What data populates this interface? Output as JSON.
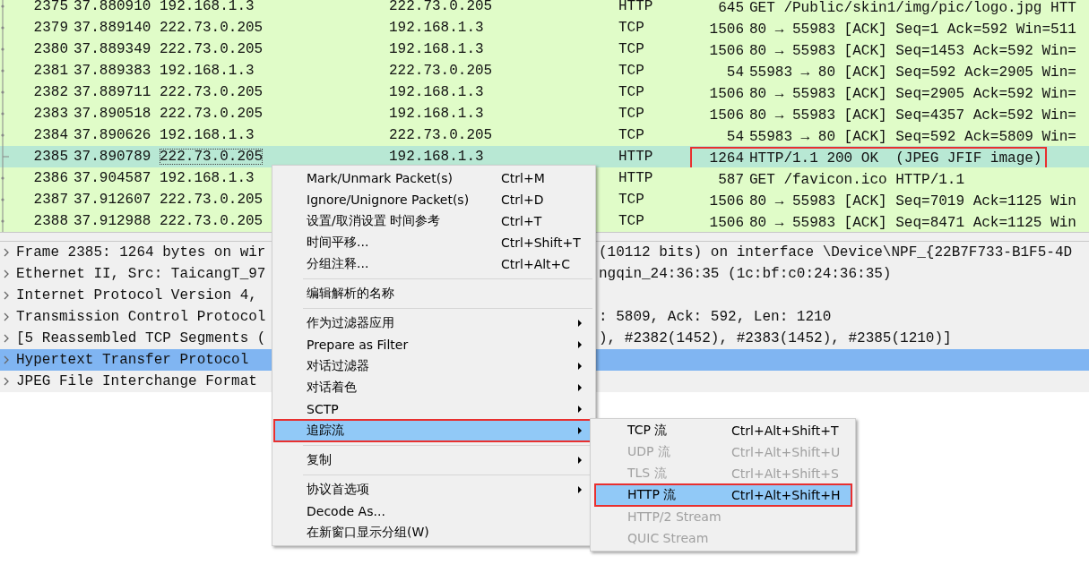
{
  "packet_list": {
    "rows": [
      {
        "no": "2375",
        "time": "37.880910",
        "source": "192.168.1.3",
        "destination": "222.73.0.205",
        "protocol": "HTTP",
        "length": "645",
        "info": "GET /Public/skin1/img/pic/logo.jpg HTT",
        "selected": false,
        "outlined": false
      },
      {
        "no": "2379",
        "time": "37.889140",
        "source": "222.73.0.205",
        "destination": "192.168.1.3",
        "protocol": "TCP",
        "length": "1506",
        "info": "80 → 55983 [ACK] Seq=1 Ack=592 Win=511",
        "selected": false,
        "outlined": false
      },
      {
        "no": "2380",
        "time": "37.889349",
        "source": "222.73.0.205",
        "destination": "192.168.1.3",
        "protocol": "TCP",
        "length": "1506",
        "info": "80 → 55983 [ACK] Seq=1453 Ack=592 Win=",
        "selected": false,
        "outlined": false
      },
      {
        "no": "2381",
        "time": "37.889383",
        "source": "192.168.1.3",
        "destination": "222.73.0.205",
        "protocol": "TCP",
        "length": "54",
        "info": "55983 → 80 [ACK] Seq=592 Ack=2905 Win=",
        "selected": false,
        "outlined": false
      },
      {
        "no": "2382",
        "time": "37.889711",
        "source": "222.73.0.205",
        "destination": "192.168.1.3",
        "protocol": "TCP",
        "length": "1506",
        "info": "80 → 55983 [ACK] Seq=2905 Ack=592 Win=",
        "selected": false,
        "outlined": false
      },
      {
        "no": "2383",
        "time": "37.890518",
        "source": "222.73.0.205",
        "destination": "192.168.1.3",
        "protocol": "TCP",
        "length": "1506",
        "info": "80 → 55983 [ACK] Seq=4357 Ack=592 Win=",
        "selected": false,
        "outlined": false
      },
      {
        "no": "2384",
        "time": "37.890626",
        "source": "192.168.1.3",
        "destination": "222.73.0.205",
        "protocol": "TCP",
        "length": "54",
        "info": "55983 → 80 [ACK] Seq=592 Ack=5809 Win=",
        "selected": false,
        "outlined": false
      },
      {
        "no": "2385",
        "time": "37.890789",
        "source": "222.73.0.205",
        "destination": "192.168.1.3",
        "protocol": "HTTP",
        "length": "1264",
        "info": "HTTP/1.1 200 OK  (JPEG JFIF image)",
        "selected": true,
        "outlined": true
      },
      {
        "no": "2386",
        "time": "37.904587",
        "source": "192.168.1.3",
        "protocol": "HTTP",
        "length": "587",
        "info": "GET /favicon.ico HTTP/1.1",
        "selected": false,
        "outlined": false
      },
      {
        "no": "2387",
        "time": "37.912607",
        "source": "222.73.0.205",
        "protocol": "TCP",
        "length": "1506",
        "info": "80 → 55983 [ACK] Seq=7019 Ack=1125 Win",
        "selected": false,
        "outlined": false
      },
      {
        "no": "2388",
        "time": "37.912988",
        "source": "222.73.0.205",
        "protocol": "TCP",
        "length": "1506",
        "info": "80 → 55983 [ACK] Seq=8471 Ack=1125 Win",
        "selected": false,
        "outlined": false
      }
    ]
  },
  "packet_details": {
    "rows": [
      {
        "left": "Frame 2385: 1264 bytes on wir",
        "right": "(10112 bits) on interface \\Device\\NPF_{22B7F733-B1F5-4D",
        "selected": false
      },
      {
        "left": "Ethernet II, Src: TaicangT_97",
        "right": "ngqin_24:36:35 (1c:bf:c0:24:36:35)",
        "selected": false
      },
      {
        "left": "Internet Protocol Version 4,",
        "selected": false
      },
      {
        "left": "Transmission Control Protocol",
        "right": ": 5809, Ack: 592, Len: 1210",
        "selected": false
      },
      {
        "left": "[5 Reassembled TCP Segments (",
        "right": "), #2382(1452), #2383(1452), #2385(1210)]",
        "selected": false
      },
      {
        "left": "Hypertext Transfer Protocol",
        "selected": true
      },
      {
        "left": "JPEG File Interchange Format",
        "selected": false
      }
    ]
  },
  "context_menu": {
    "items": [
      {
        "kind": "item",
        "label": "Mark/Unmark Packet(s)",
        "shortcut": "Ctrl+M",
        "selected": false,
        "outlined": false
      },
      {
        "kind": "item",
        "label": "Ignore/Unignore Packet(s)",
        "shortcut": "Ctrl+D",
        "selected": false,
        "outlined": false
      },
      {
        "kind": "item",
        "label": "设置/取消设置 时间参考",
        "shortcut": "Ctrl+T",
        "selected": false,
        "outlined": false
      },
      {
        "kind": "item",
        "label": "时间平移...",
        "shortcut": "Ctrl+Shift+T",
        "selected": false,
        "outlined": false
      },
      {
        "kind": "item",
        "label": "分组注释...",
        "shortcut": "Ctrl+Alt+C",
        "selected": false,
        "outlined": false
      },
      {
        "kind": "separator"
      },
      {
        "kind": "item",
        "label": "编辑解析的名称",
        "selected": false,
        "outlined": false
      },
      {
        "kind": "separator"
      },
      {
        "kind": "submenu",
        "label": "作为过滤器应用",
        "selected": false,
        "outlined": false
      },
      {
        "kind": "submenu",
        "label": "Prepare as Filter",
        "selected": false,
        "outlined": false
      },
      {
        "kind": "submenu",
        "label": "对话过滤器",
        "selected": false,
        "outlined": false
      },
      {
        "kind": "submenu",
        "label": "对话着色",
        "selected": false,
        "outlined": false
      },
      {
        "kind": "submenu",
        "label": "SCTP",
        "selected": false,
        "outlined": false
      },
      {
        "kind": "submenu",
        "label": "追踪流",
        "selected": true,
        "outlined": true
      },
      {
        "kind": "separator"
      },
      {
        "kind": "submenu",
        "label": "复制",
        "selected": false,
        "outlined": false
      },
      {
        "kind": "separator"
      },
      {
        "kind": "submenu",
        "label": "协议首选项",
        "selected": false,
        "outlined": false
      },
      {
        "kind": "item",
        "label": "Decode As...",
        "selected": false,
        "outlined": false
      },
      {
        "kind": "item",
        "label": "在新窗口显示分组(W)",
        "selected": false,
        "outlined": false
      }
    ]
  },
  "submenu": {
    "items": [
      {
        "label": "TCP 流",
        "shortcut": "Ctrl+Alt+Shift+T",
        "disabled": false,
        "selected": false,
        "outlined": false
      },
      {
        "label": "UDP 流",
        "shortcut": "Ctrl+Alt+Shift+U",
        "disabled": true,
        "selected": false,
        "outlined": false
      },
      {
        "label": "TLS 流",
        "shortcut": "Ctrl+Alt+Shift+S",
        "disabled": true,
        "selected": false,
        "outlined": false
      },
      {
        "label": "HTTP 流",
        "shortcut": "Ctrl+Alt+Shift+H",
        "disabled": false,
        "selected": true,
        "outlined": true
      },
      {
        "label": "HTTP/2 Stream",
        "disabled": true,
        "selected": false,
        "outlined": false
      },
      {
        "label": "QUIC Stream",
        "disabled": true,
        "selected": false,
        "outlined": false
      }
    ]
  }
}
